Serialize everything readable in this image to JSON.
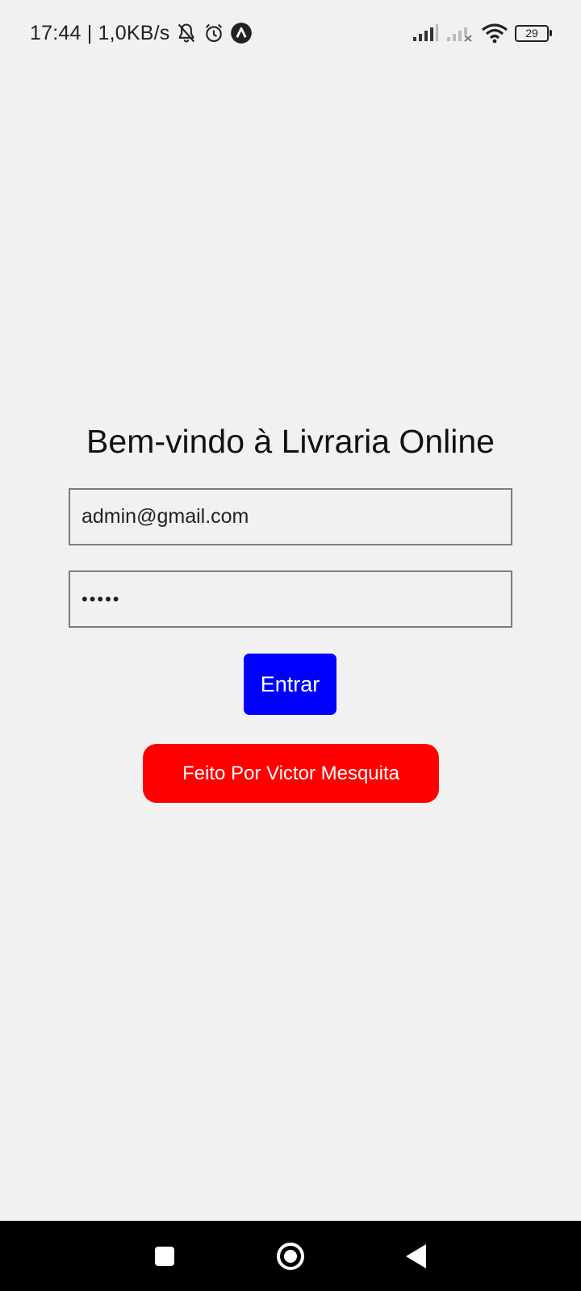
{
  "status_bar": {
    "time_and_speed": "17:44 | 1,0KB/s",
    "icons": [
      "bell-off-icon",
      "alarm-icon",
      "app-notification-icon",
      "signal-icon",
      "signal-no-service-icon",
      "wifi-icon",
      "battery-icon"
    ],
    "battery_level": "29"
  },
  "login": {
    "title": "Bem-vindo à Livraria Online",
    "email_value": "admin@gmail.com",
    "password_value": "•••••",
    "enter_label": "Entrar",
    "credit_label": "Feito Por Victor Mesquita"
  },
  "colors": {
    "background": "#f2f1f2",
    "enter_button": "#0000ff",
    "credit_button": "#ff0000",
    "field_border": "#7d7d7d",
    "nav_bar": "#000000"
  },
  "nav_bar": {
    "buttons": [
      "recents-icon",
      "home-icon",
      "back-icon"
    ]
  }
}
